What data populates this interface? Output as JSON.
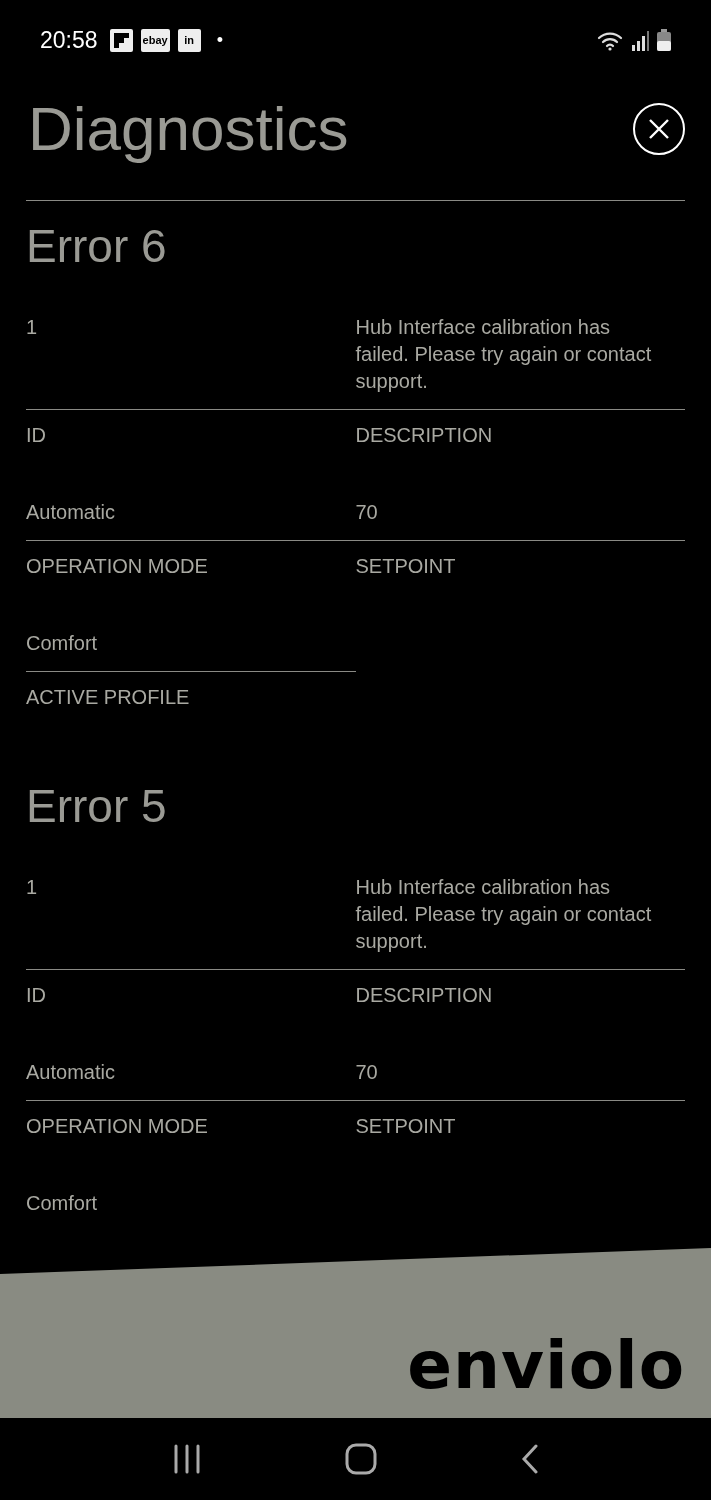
{
  "status_bar": {
    "time": "20:58",
    "notifications": [
      {
        "kind": "flip"
      },
      {
        "kind": "text",
        "text": "ebay"
      },
      {
        "kind": "text",
        "text": "in"
      }
    ],
    "dot": "•"
  },
  "title": "Diagnostics",
  "errors": [
    {
      "title": "Error 6",
      "fields": [
        {
          "value": "1",
          "label": "ID"
        },
        {
          "value": "Hub Interface calibration has failed. Please try again or contact support.",
          "label": "DESCRIPTION"
        },
        {
          "value": "Automatic",
          "label": "OPERATION MODE"
        },
        {
          "value": "70",
          "label": "SETPOINT"
        },
        {
          "value": "Comfort",
          "label": "ACTIVE PROFILE"
        }
      ]
    },
    {
      "title": "Error 5",
      "fields": [
        {
          "value": "1",
          "label": "ID"
        },
        {
          "value": "Hub Interface calibration has failed. Please try again or contact support.",
          "label": "DESCRIPTION"
        },
        {
          "value": "Automatic",
          "label": "OPERATION MODE"
        },
        {
          "value": "70",
          "label": "SETPOINT"
        },
        {
          "value": "Comfort"
        }
      ]
    }
  ],
  "brand": "enviolo"
}
